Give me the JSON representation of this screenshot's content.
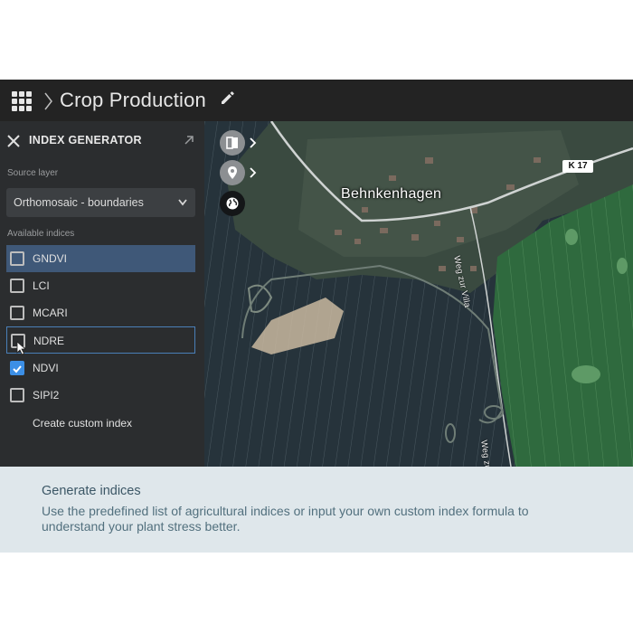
{
  "header": {
    "title": "Crop Production",
    "icons": {
      "apps": "apps-grid-icon",
      "breadcrumb": "chevron-right-icon",
      "edit": "pencil-icon"
    }
  },
  "panel": {
    "title": "INDEX GENERATOR",
    "source_label": "Source layer",
    "source_value": "Orthomosaic - boundaries",
    "available_label": "Available indices",
    "indices": [
      {
        "label": "GNDVI",
        "checked": false,
        "state": "hover"
      },
      {
        "label": "LCI",
        "checked": false,
        "state": ""
      },
      {
        "label": "MCARI",
        "checked": false,
        "state": ""
      },
      {
        "label": "NDRE",
        "checked": false,
        "state": "focus"
      },
      {
        "label": "NDVI",
        "checked": true,
        "state": ""
      },
      {
        "label": "SIPI2",
        "checked": false,
        "state": ""
      }
    ],
    "custom_index": "Create custom index"
  },
  "map": {
    "place_label": "Behnkenhagen",
    "road_label": "K 17",
    "street_label_1": "Weg zur Villa",
    "street_label_2": "Weg zur Villa",
    "tools": [
      "layers-compare-icon",
      "location-pin-icon",
      "globe-icon"
    ]
  },
  "caption": {
    "title": "Generate indices",
    "body": "Use the predefined list of agricultural indices or input your own custom index formula to understand your plant stress better."
  },
  "colors": {
    "header_bg": "#232323",
    "panel_bg": "#2b2d2f",
    "accent": "#3c8fe6",
    "hover_row": "#3f5878",
    "caption_bg": "#dee6ea",
    "caption_text": "#3c5766"
  }
}
